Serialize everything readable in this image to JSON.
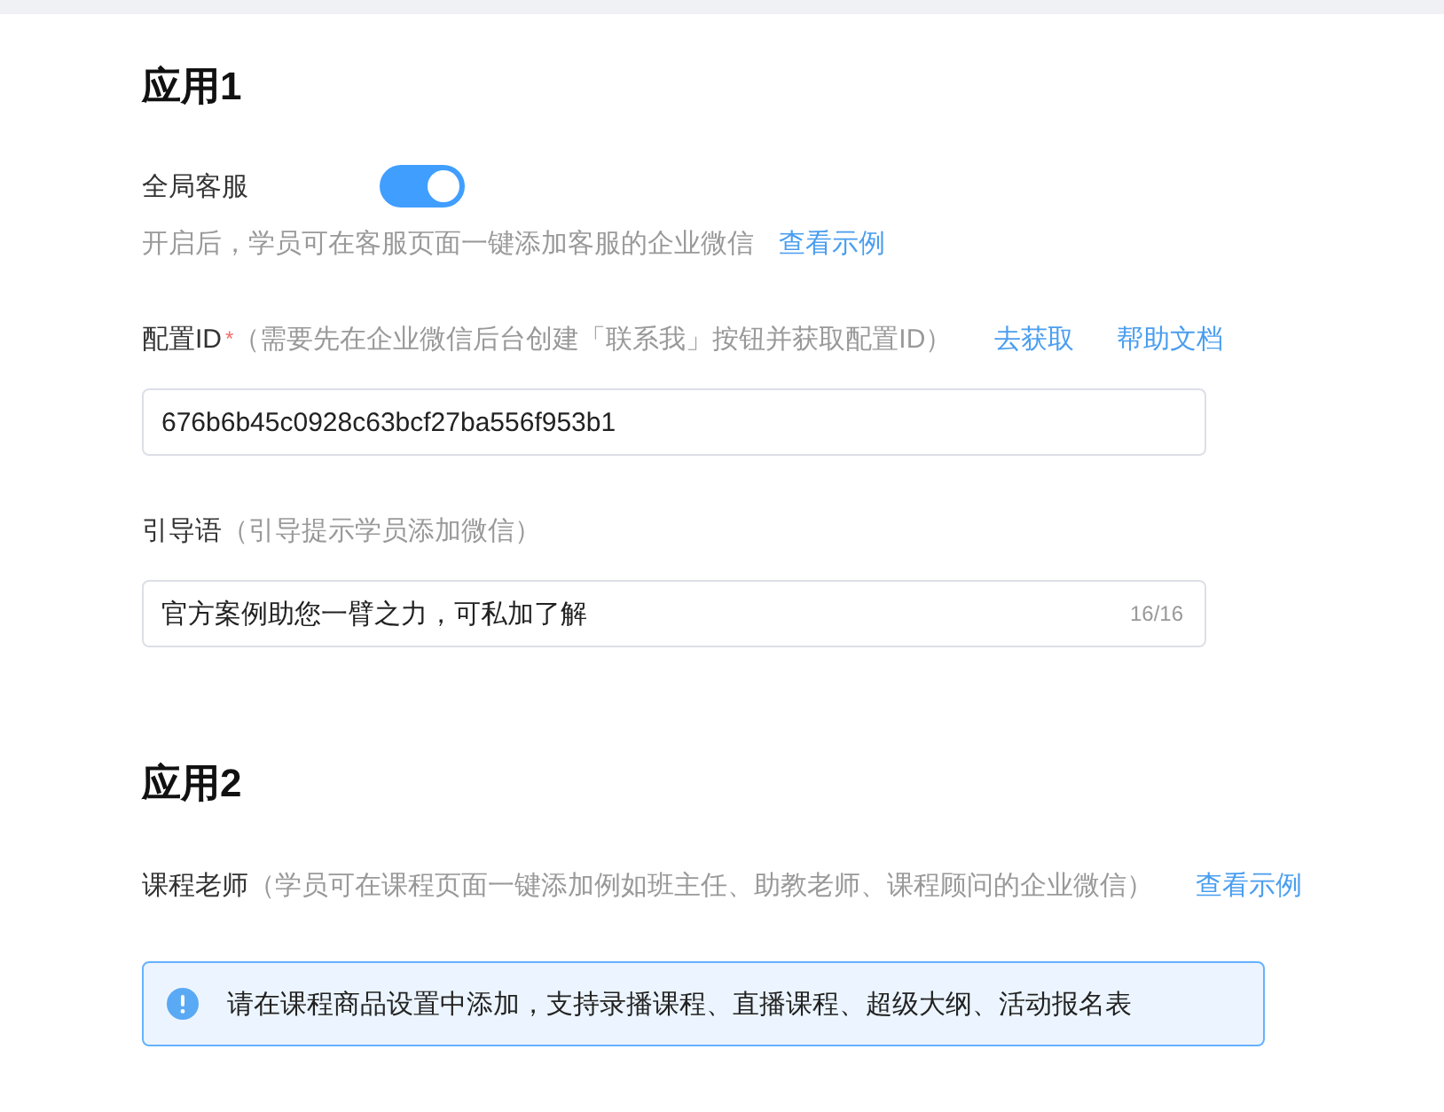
{
  "sections": [
    {
      "title": "应用1",
      "kind": "app1",
      "toggle": {
        "label": "全局客服",
        "on": true
      },
      "hint": {
        "text": "开启后，学员可在客服页面一键添加客服的企业微信",
        "link": "查看示例"
      },
      "fields": [
        {
          "label": "配置ID",
          "required_mark": "*",
          "note": "（需要先在企业微信后台创建「联系我」按钮并获取配置ID）",
          "links": [
            "去获取",
            "帮助文档"
          ],
          "value": "676b6b45c0928c63bcf27ba556f953b1"
        },
        {
          "label": "引导语",
          "note": "（引导提示学员添加微信）",
          "value": "官方案例助您一臂之力，可私加了解",
          "counter": "16/16"
        }
      ]
    },
    {
      "title": "应用2",
      "kind": "app2",
      "row": {
        "label": "课程老师",
        "note": "（学员可在课程页面一键添加例如班主任、助教老师、课程顾问的企业微信）",
        "link": "查看示例"
      },
      "alert": {
        "text": "请在课程商品设置中添加，支持录播课程、直播课程、超级大纲、活动报名表"
      }
    }
  ]
}
